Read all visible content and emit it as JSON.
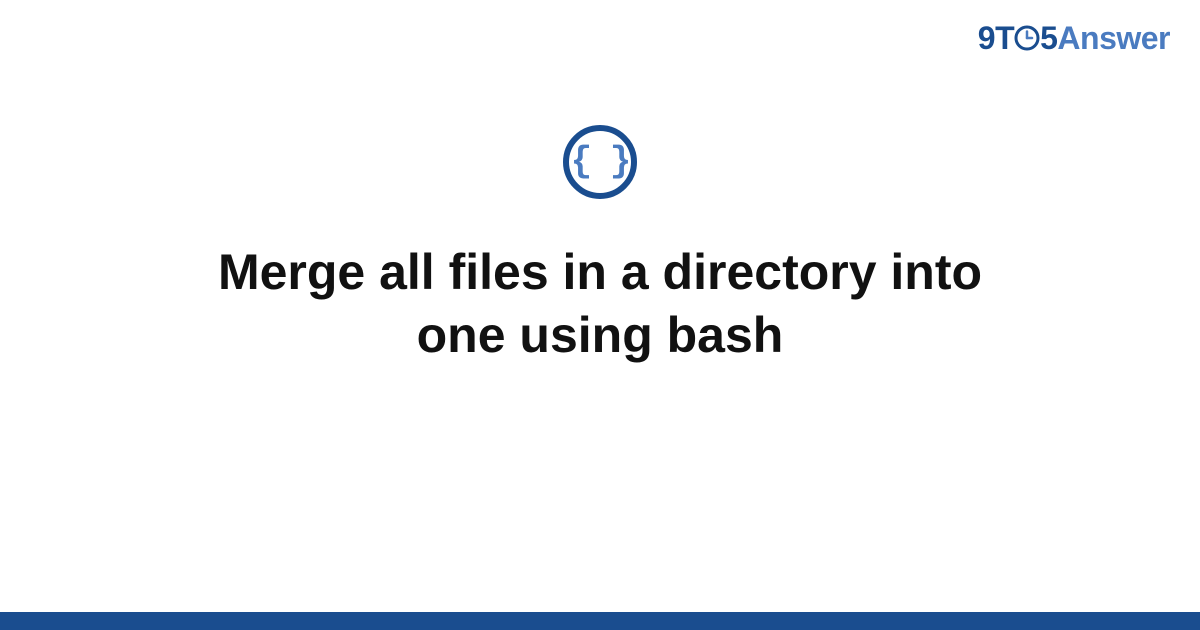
{
  "logo": {
    "part_9t": "9T",
    "part_5": "5",
    "part_answer": "Answer"
  },
  "icon": {
    "braces_content": "{ }",
    "ring_color": "#1a4d8f",
    "brace_color": "#4a7bc0"
  },
  "title": "Merge all files in a directory into one using bash",
  "footer_color": "#1a4d8f"
}
